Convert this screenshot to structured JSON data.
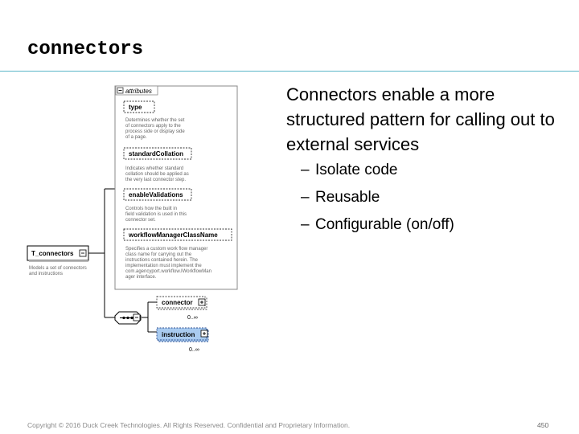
{
  "slide": {
    "title": "connectors",
    "page_number": "450",
    "footer": "Copyright © 2016 Duck Creek Technologies. All Rights Reserved. Confidential and Proprietary Information."
  },
  "bullets": {
    "main": "Connectors enable a more structured pattern for calling out to external services",
    "sub": [
      "Isolate code",
      "Reusable",
      "Configurable (on/off)"
    ],
    "dash": "–"
  },
  "diagram": {
    "root": {
      "label": "T_connectors",
      "desc": [
        "Models a set of connectors",
        "and instructions"
      ]
    },
    "attributes_group": {
      "label": "attributes",
      "items": [
        {
          "name": "type",
          "desc": [
            "Determines whether the set",
            "of connectors apply to the",
            "process side or display side",
            "of a page."
          ]
        },
        {
          "name": "standardCollation",
          "desc": [
            "Indicates whether standard",
            "collation should be applied as",
            "the very last connector step."
          ]
        },
        {
          "name": "enableValidations",
          "desc": [
            "Controls how the built in",
            "field validation is used in this",
            "connector set."
          ]
        },
        {
          "name": "workflowManagerClassName",
          "desc": [
            "Specifies a custom work flow manager",
            "class name for carrying out the",
            "instructions contained herein. The",
            "implementation must implement the",
            "com.agencyport.workflow.IWorkflowMan",
            "ager interface."
          ]
        }
      ]
    },
    "sequence": {
      "children": [
        {
          "name": "connector",
          "cardinality": "0..∞"
        },
        {
          "name": "instruction",
          "cardinality": "0..∞"
        }
      ]
    },
    "colors": {
      "instruction_fill": "#a9cbf0",
      "title_rule": "#5ab6c8"
    }
  }
}
